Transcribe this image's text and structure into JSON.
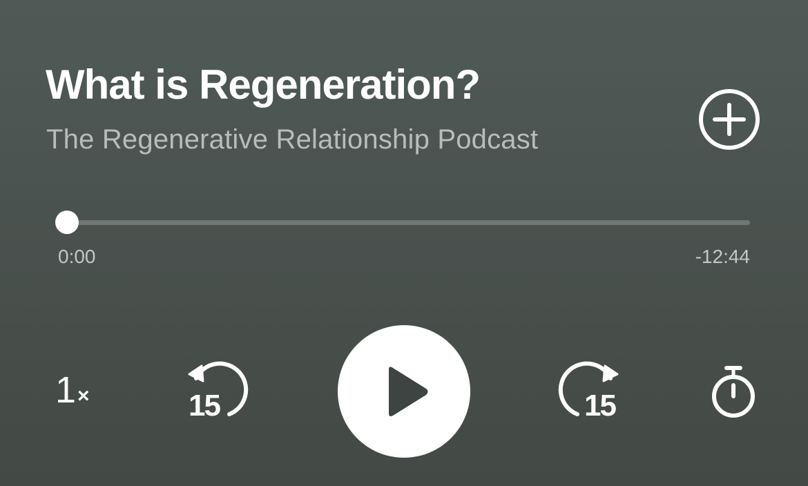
{
  "episode": {
    "title": "What is Regeneration?",
    "podcast": "The Regenerative Relationship Podcast"
  },
  "playback": {
    "elapsed": "0:00",
    "remaining": "-12:44",
    "progress_fraction": 0.0
  },
  "controls": {
    "speed_value": "1",
    "speed_suffix": "×",
    "skip_back_seconds": "15",
    "skip_forward_seconds": "15"
  },
  "icons": {
    "add": "plus-circle-icon",
    "skip_back": "rotate-ccw-icon",
    "play": "play-icon",
    "skip_forward": "rotate-cw-icon",
    "sleep_timer": "stopwatch-icon"
  },
  "colors": {
    "background_top": "#4f5a56",
    "background_bottom": "#434944",
    "primary": "#ffffff",
    "secondary_text": "#b8bdba",
    "track": "#6f7874"
  }
}
